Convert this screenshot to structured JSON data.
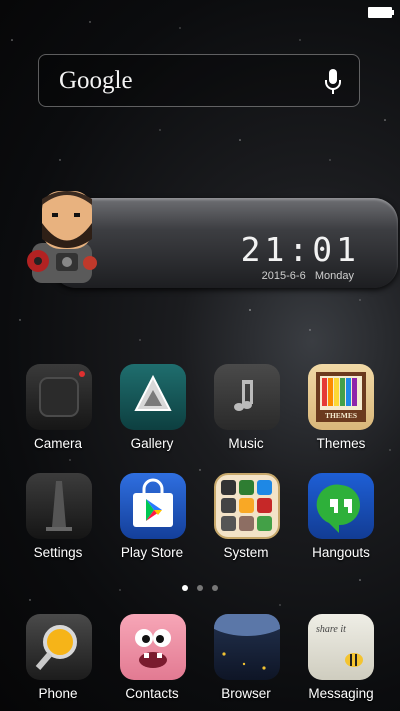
{
  "search": {
    "label": "Google"
  },
  "clock": {
    "time": "21:01",
    "date": "2015-6-6   Monday"
  },
  "home_apps": [
    {
      "id": "camera",
      "label": "Camera"
    },
    {
      "id": "gallery",
      "label": "Gallery"
    },
    {
      "id": "music",
      "label": "Music"
    },
    {
      "id": "themes",
      "label": "Themes",
      "icon_text": "THEMES"
    },
    {
      "id": "settings",
      "label": "Settings"
    },
    {
      "id": "playstore",
      "label": "Play Store"
    },
    {
      "id": "system",
      "label": "System"
    },
    {
      "id": "hangouts",
      "label": "Hangouts"
    }
  ],
  "dock_apps": [
    {
      "id": "phone",
      "label": "Phone"
    },
    {
      "id": "contacts",
      "label": "Contacts"
    },
    {
      "id": "browser",
      "label": "Browser"
    },
    {
      "id": "messaging",
      "label": "Messaging",
      "icon_text": "share it"
    }
  ],
  "pages": {
    "count": 3,
    "active": 1
  }
}
